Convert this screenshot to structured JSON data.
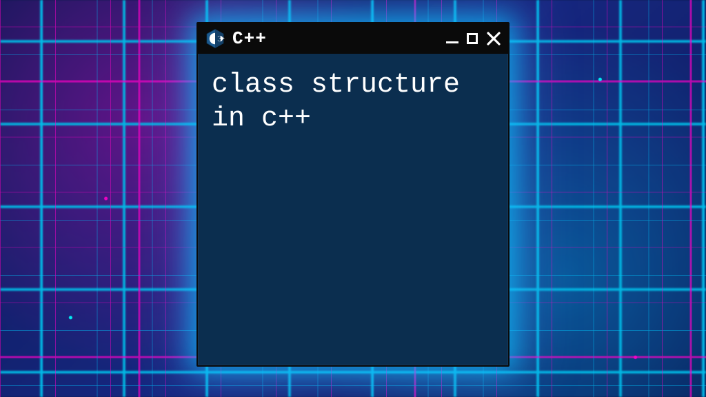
{
  "window": {
    "title": "C++",
    "icon": "cpp-icon"
  },
  "content": {
    "text": "class structure in c++"
  },
  "controls": {
    "minimize": "minimize",
    "maximize": "maximize",
    "close": "close"
  }
}
